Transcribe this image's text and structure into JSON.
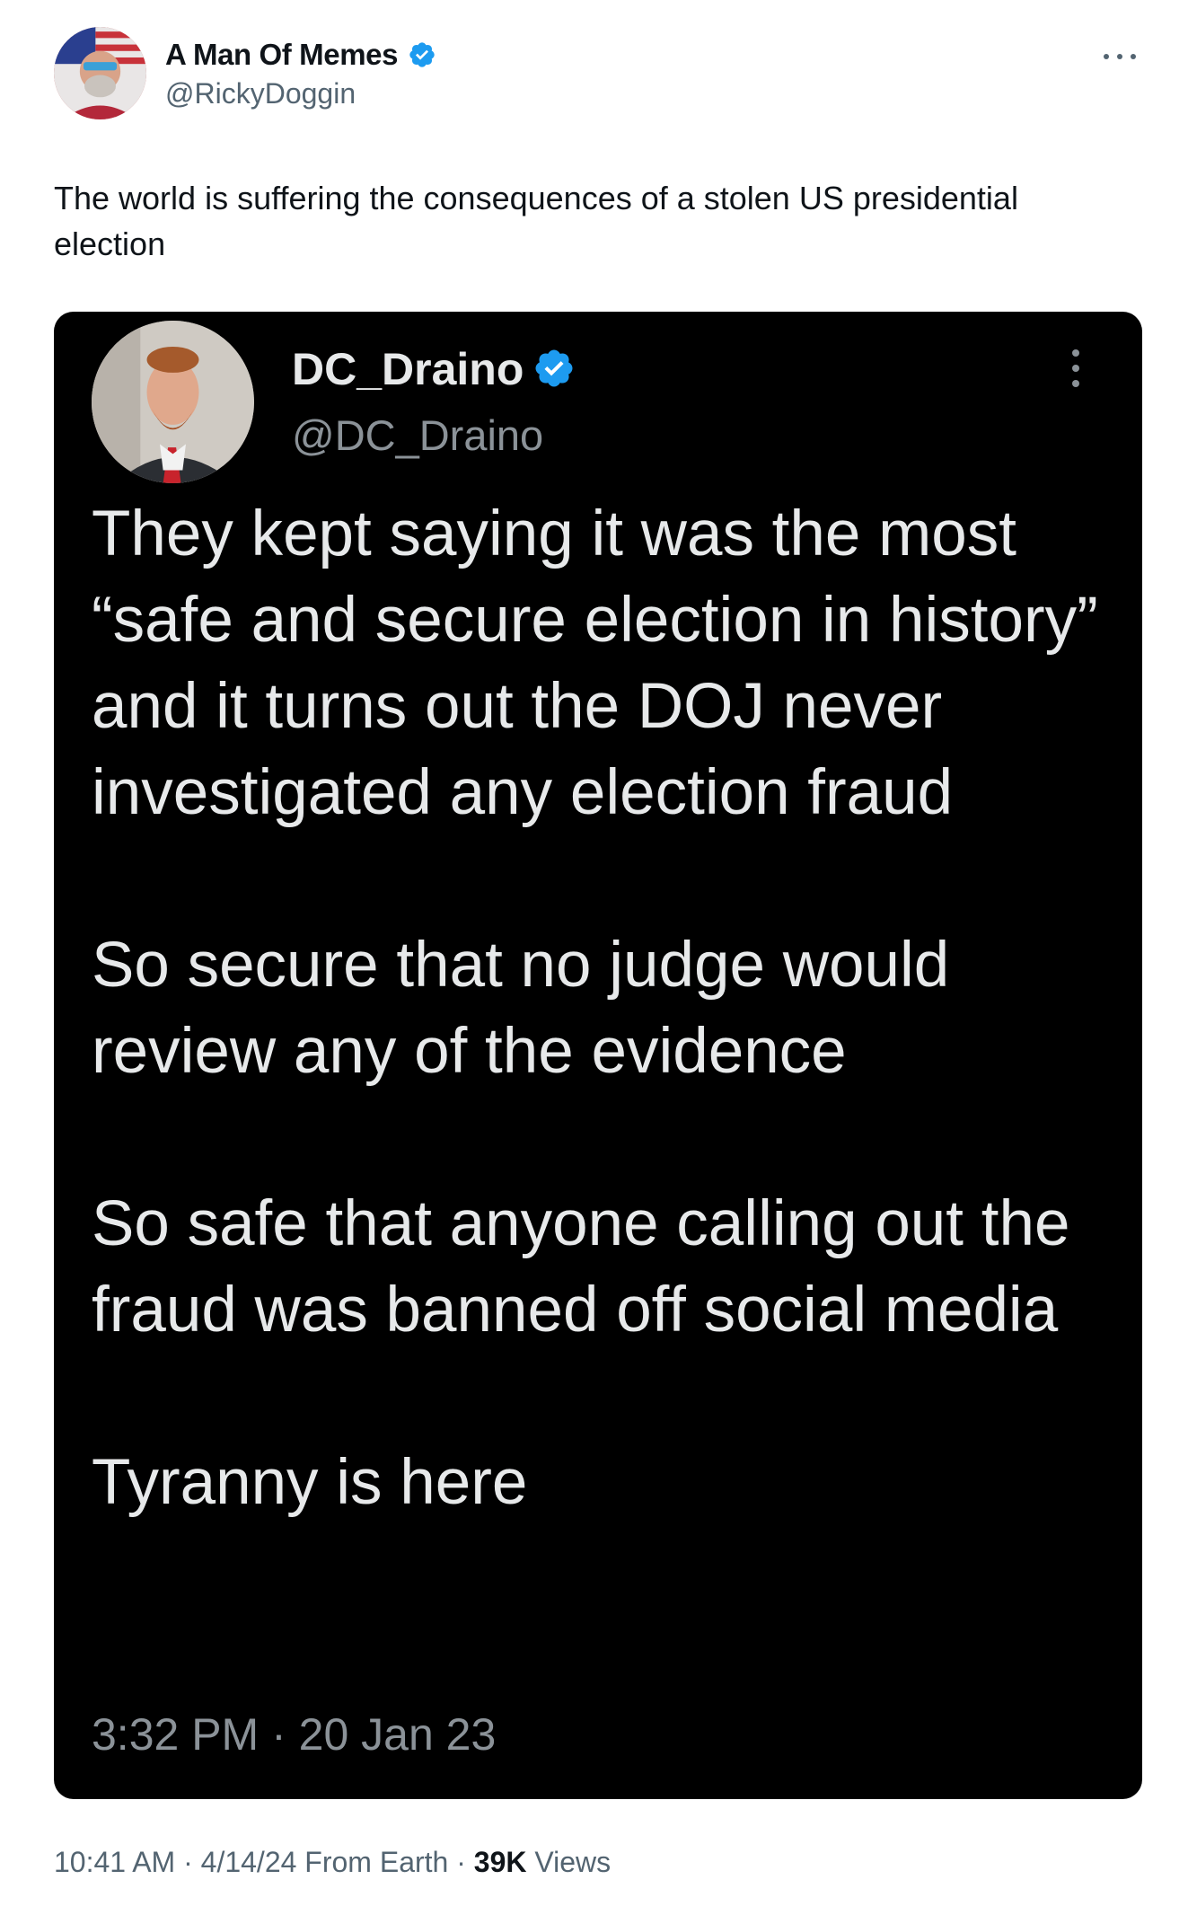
{
  "author": {
    "display_name": "A Man Of Memes",
    "handle": "@RickyDoggin",
    "verified_icon": "verified-badge-icon",
    "badge_color": "#1d9bf0"
  },
  "more_icon": "more-horizontal-icon",
  "tweet_text": "The world is suffering the consequences of a stolen US presidential election",
  "embedded_post": {
    "display_name": "DC_Draino",
    "handle": "@DC_Draino",
    "paragraphs": [
      "They kept saying it was the most “safe and secure election in history” and it turns out the DOJ never investigated any election fraud",
      "So secure that no judge would review any of the evidence",
      "So safe that anyone calling out the fraud was banned off social media",
      "Tyranny is here"
    ],
    "timestamp": "3:32 PM · 20 Jan 23",
    "background_color": "#000000"
  },
  "footer": {
    "timestamp": "10:41 AM · 4/14/24 From Earth · ",
    "views_count": "39K",
    "views_label": " Views"
  }
}
